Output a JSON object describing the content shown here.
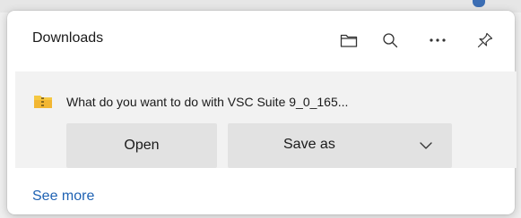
{
  "panel": {
    "title": "Downloads"
  },
  "toolbar": {
    "icons": [
      "folder-icon",
      "search-icon",
      "more-icon",
      "pin-icon"
    ]
  },
  "download_item": {
    "prompt": "What do you want to do with VSC Suite 9_0_165...",
    "open_label": "Open",
    "save_as_label": "Save as",
    "file_icon": "folder-zip-icon"
  },
  "footer": {
    "see_more_label": "See more"
  },
  "colors": {
    "link": "#1f62b3",
    "item_background": "#f2f2f2",
    "button_background": "#e2e2e2",
    "zip_folder_yellow": "#f5c842"
  }
}
